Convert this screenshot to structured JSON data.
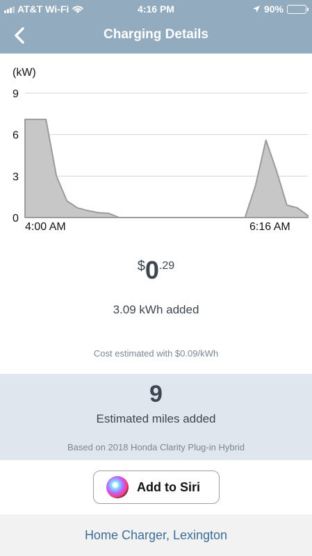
{
  "status_bar": {
    "carrier": "AT&T Wi-Fi",
    "time": "4:16 PM",
    "battery": "90%",
    "battery_level": 0.9
  },
  "nav": {
    "title": "Charging Details",
    "back_icon": "chevron-left-icon"
  },
  "chart_data": {
    "type": "area",
    "unit_label": "(kW)",
    "y_ticks": [
      "9",
      "6",
      "3",
      "0"
    ],
    "ylim": [
      0,
      9
    ],
    "x_labels": [
      "4:00 AM",
      "6:16 AM"
    ],
    "grid": true,
    "series": [
      {
        "values": [
          7.1,
          7.1,
          7.1,
          3.0,
          1.2,
          0.7,
          0.5,
          0.35,
          0.3,
          0.0,
          0.0,
          0.0,
          0.0,
          0.0,
          0.0,
          0.0,
          0.0,
          0.0,
          0.0,
          0.0,
          0.0,
          0.0,
          2.3,
          5.6,
          3.4,
          0.9,
          0.7,
          0.15
        ],
        "color": "#c7c7c7",
        "stroke": "#9b9b9b"
      }
    ]
  },
  "cost": {
    "symbol": "$",
    "whole": "0",
    "cents": ".29"
  },
  "energy_added": "3.09 kWh added",
  "cost_note": "Cost estimated with $0.09/kWh",
  "miles": {
    "value": "9",
    "label": "Estimated miles added",
    "note": "Based on 2018 Honda Clarity Plug-in Hybrid"
  },
  "siri_button": {
    "label": "Add to Siri",
    "icon": "siri-icon"
  },
  "location": "Home Charger, Lexington",
  "colors": {
    "header": "#92abbf",
    "panel": "#dfe6ed",
    "link": "#3b6d96",
    "area": "#c7c7c7"
  }
}
